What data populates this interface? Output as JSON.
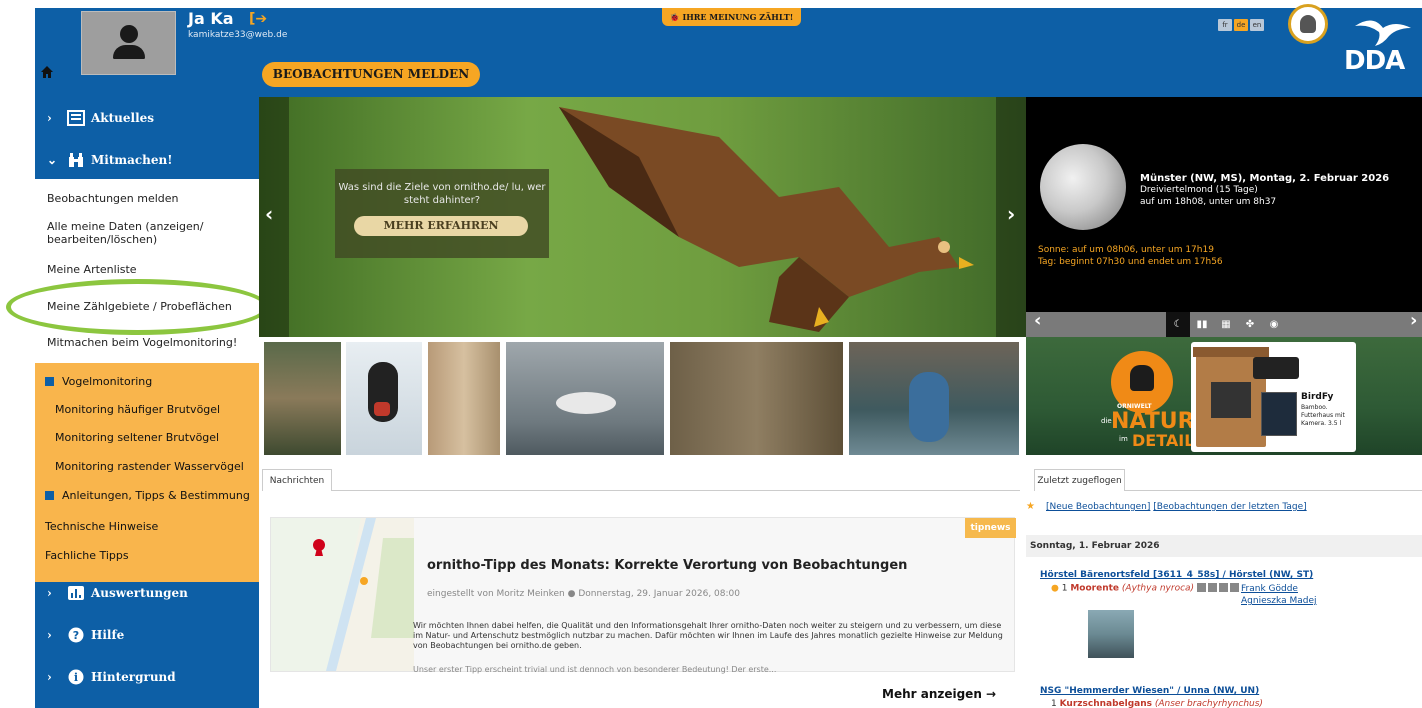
{
  "user": {
    "name": "Ja Ka",
    "email": "kamikatze33@web.de"
  },
  "header": {
    "meinung_badge": "IHRE MEINUNG ZÄHLT!",
    "report_button": "BEOBACHTUNGEN MELDEN",
    "languages": [
      "fr",
      "de",
      "en"
    ],
    "active_language": "de",
    "logo_text": "DDA"
  },
  "sidebar": {
    "sections": [
      {
        "label": "Aktuelles",
        "expanded": false
      },
      {
        "label": "Mitmachen!",
        "expanded": true
      },
      {
        "label": "Auswertungen",
        "expanded": false
      },
      {
        "label": "Hilfe",
        "expanded": false
      },
      {
        "label": "Hintergrund",
        "expanded": false
      }
    ],
    "mitmachen_items": [
      "Beobachtungen melden",
      "Alle meine Daten (anzeigen/ bearbeiten/löschen)",
      "Meine Artenliste",
      "Meine Zählgebiete / Probeflächen",
      "Mitmachen beim Vogelmonitoring!"
    ],
    "monitoring": {
      "head1": "Vogelmonitoring",
      "items1": [
        "Monitoring häufiger Brutvögel",
        "Monitoring seltener Brutvögel",
        "Monitoring rastender Wasservögel"
      ],
      "head2": "Anleitungen, Tipps & Bestimmung",
      "items2": [
        "Technische Hinweise",
        "Fachliche Tipps"
      ]
    }
  },
  "hero": {
    "text": "Was sind die Ziele von ornitho.de/ lu, wer steht dahinter?",
    "button": "MEHR ERFAHREN"
  },
  "moon": {
    "title": "Münster (NW, MS), Montag, 2. Februar 2026",
    "phase": "Dreiviertelmond (15 Tage)",
    "times": "auf um 18h08, unter um 8h37",
    "sun": "Sonne: auf um 08h06, unter um 17h19",
    "day": "Tag: beginnt 07h30 und endet um 17h56"
  },
  "ad": {
    "brand": "ORNIWELT",
    "die": "die",
    "natur": "NATUR",
    "im": "im",
    "detail": "DETAIL",
    "product": "BirdFy",
    "desc": "Bamboo. Futterhaus mit Kamera. 3.5 l"
  },
  "news": {
    "tab": "Nachrichten",
    "badge": "tipnews",
    "title": "ornitho-Tipp des Monats: Korrekte Verortung von Beobachtungen",
    "meta": "eingestellt von Moritz Meinken ● Donnerstag, 29. Januar 2026, 08:00",
    "body": "Wir möchten Ihnen dabei helfen, die Qualität und den Informationsgehalt Ihrer ornitho-Daten noch weiter zu steigern und zu verbessern, um diese im Natur- und Artenschutz bestmöglich nutzbar zu machen. Dafür möchten wir Ihnen im Laufe des Jahres monatlich gezielte Hinweise zur Meldung von Beobachtungen bei ornitho.de geben.",
    "teaser": "Unser erster Tipp erscheint trivial und ist dennoch von besonderer Bedeutung! Der erste...",
    "more": "Mehr anzeigen →"
  },
  "recent": {
    "tab": "Zuletzt zugeflogen",
    "link1": "[Neue Beobachtungen]",
    "link2": "[Beobachtungen der letzten Tage]",
    "date": "Sonntag, 1. Februar 2026",
    "loc1": "Hörstel Bärenortsfeld [3611_4_58s] / Hörstel (NW, ST)",
    "obs1_count": "1",
    "obs1_species": "Moorente",
    "obs1_latin": "(Aythya nyroca)",
    "observer1": "Frank Gödde",
    "observer2": "Agnieszka Madej",
    "loc2": "NSG \"Hemmerder Wiesen\" / Unna (NW, UN)",
    "obs2_count": "1",
    "obs2_species": "Kurzschnabelgans",
    "obs2_latin": "(Anser brachyrhynchus)"
  },
  "colors": {
    "primary": "#0d5fa6",
    "accent": "#f6a623",
    "orange_menu": "#f9b54c",
    "highlight": "#8cc63f"
  }
}
